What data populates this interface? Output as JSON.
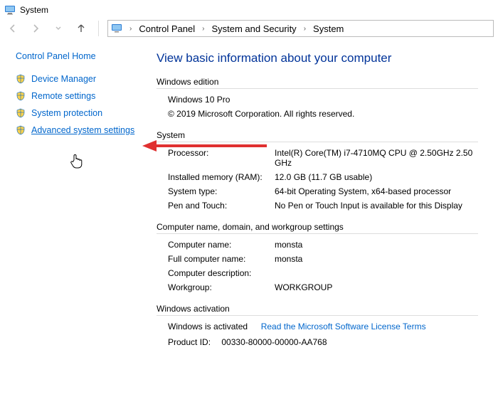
{
  "window": {
    "title": "System"
  },
  "breadcrumb": {
    "seg1": "Control Panel",
    "seg2": "System and Security",
    "seg3": "System"
  },
  "sidebar": {
    "home": "Control Panel Home",
    "items": [
      {
        "label": "Device Manager"
      },
      {
        "label": "Remote settings"
      },
      {
        "label": "System protection"
      },
      {
        "label": "Advanced system settings"
      }
    ]
  },
  "page": {
    "title": "View basic information about your computer",
    "win_edition": {
      "head": "Windows edition",
      "name": "Windows 10 Pro",
      "copyright": "© 2019 Microsoft Corporation. All rights reserved."
    },
    "system": {
      "head": "System",
      "processor_label": "Processor:",
      "processor_value": "Intel(R) Core(TM) i7-4710MQ CPU @ 2.50GHz   2.50 GHz",
      "ram_label": "Installed memory (RAM):",
      "ram_value": "12.0 GB (11.7 GB usable)",
      "type_label": "System type:",
      "type_value": "64-bit Operating System, x64-based processor",
      "pen_label": "Pen and Touch:",
      "pen_value": "No Pen or Touch Input is available for this Display"
    },
    "identity": {
      "head": "Computer name, domain, and workgroup settings",
      "cname_label": "Computer name:",
      "cname_value": "monsta",
      "fcname_label": "Full computer name:",
      "fcname_value": "monsta",
      "cdesc_label": "Computer description:",
      "cdesc_value": "",
      "wg_label": "Workgroup:",
      "wg_value": "WORKGROUP"
    },
    "activation": {
      "head": "Windows activation",
      "status": "Windows is activated",
      "read_terms": "Read the Microsoft Software License Terms",
      "pid_label": "Product ID:",
      "pid_value": "00330-80000-00000-AA768"
    }
  }
}
